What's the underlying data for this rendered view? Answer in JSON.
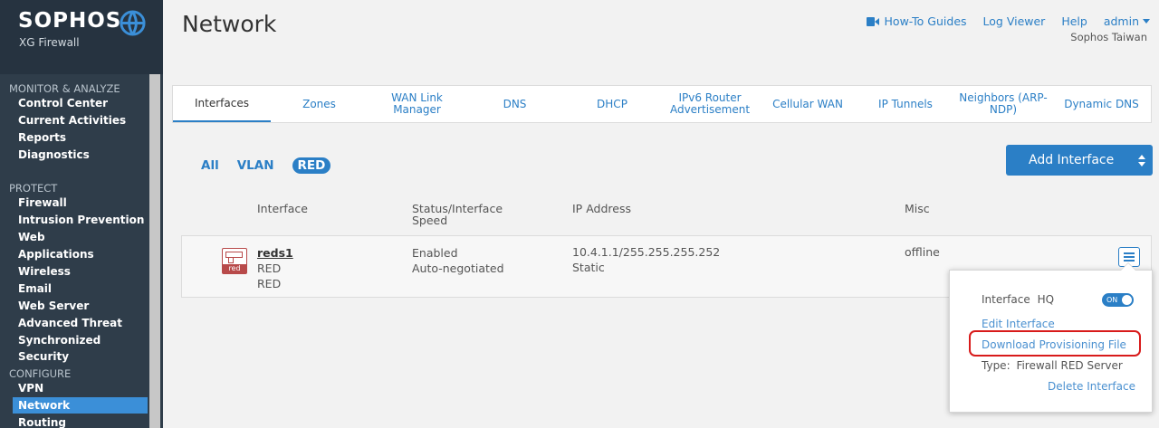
{
  "brand": {
    "name": "SOPHOS",
    "product": "XG Firewall"
  },
  "sidebar": {
    "monitor_title": "MONITOR & ANALYZE",
    "monitor_items": [
      "Control Center",
      "Current Activities",
      "Reports",
      "Diagnostics"
    ],
    "protect_title": "PROTECT",
    "protect_items": [
      "Firewall",
      "Intrusion Prevention",
      "Web",
      "Applications",
      "Wireless",
      "Email",
      "Web Server",
      "Advanced Threat",
      "Synchronized Security"
    ],
    "configure_title": "CONFIGURE",
    "configure_items": [
      "VPN",
      "Network",
      "Routing"
    ],
    "active_item": "Network"
  },
  "header": {
    "title": "Network",
    "links": {
      "guides": "How-To Guides",
      "log_viewer": "Log Viewer",
      "help": "Help",
      "user": "admin"
    },
    "org": "Sophos Taiwan"
  },
  "tabs": [
    "Interfaces",
    "Zones",
    "WAN Link Manager",
    "DNS",
    "DHCP",
    "IPv6 Router Advertisement",
    "Cellular WAN",
    "IP Tunnels",
    "Neighbors (ARP-NDP)",
    "Dynamic DNS"
  ],
  "active_tab": "Interfaces",
  "filters": [
    "All",
    "VLAN",
    "RED"
  ],
  "active_filter": "RED",
  "add_button": "Add Interface",
  "table": {
    "headers": {
      "interface": "Interface",
      "status": "Status/Interface Speed",
      "ip": "IP Address",
      "misc": "Misc"
    },
    "row": {
      "icon_label": "red",
      "name": "reds1",
      "line2": "RED",
      "line3": "RED",
      "status": "Enabled",
      "speed": "Auto-negotiated",
      "ip": "10.4.1.1/255.255.255.252",
      "ip_mode": "Static",
      "misc": "offline"
    }
  },
  "popover": {
    "interface_label": "Interface",
    "interface_value": "HQ",
    "toggle": "ON",
    "edit": "Edit Interface",
    "download": "Download Provisioning File",
    "type_label": "Type:",
    "type_value": "Firewall RED Server",
    "delete": "Delete Interface"
  }
}
